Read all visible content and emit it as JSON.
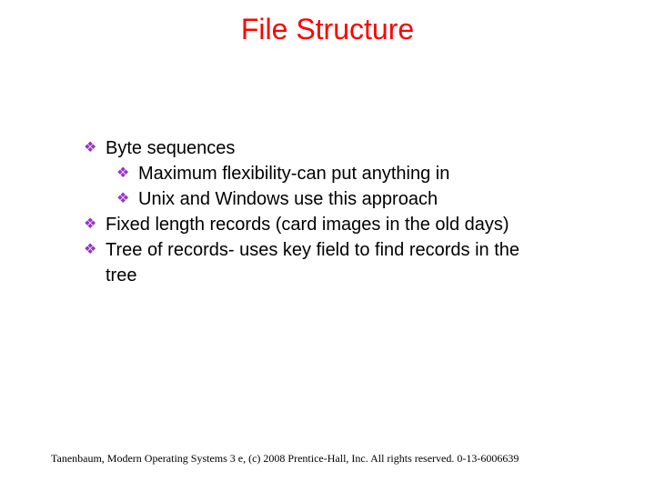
{
  "title": "File Structure",
  "bullets": {
    "b1": "Byte sequences",
    "b1a": "Maximum flexibility-can put anything in",
    "b1b": "Unix and Windows use this approach",
    "b2": "Fixed length records (card images in the old days)",
    "b3": "Tree of records- uses key field to find records in the",
    "b3_cont": "tree"
  },
  "bullet_glyph": "❖",
  "footer": "Tanenbaum, Modern Operating Systems 3 e, (c) 2008 Prentice-Hall, Inc. All rights reserved. 0-13-6006639"
}
